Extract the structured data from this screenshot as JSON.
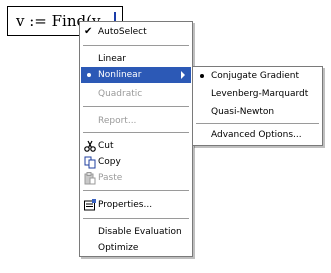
{
  "math": {
    "expression": "v := Find(v"
  },
  "main_menu": {
    "autoselect": "AutoSelect",
    "linear": "Linear",
    "nonlinear": "Nonlinear",
    "quadratic": "Quadratic",
    "report": "Report...",
    "cut": "Cut",
    "copy": "Copy",
    "paste": "Paste",
    "properties": "Properties...",
    "disable_evaluation": "Disable Evaluation",
    "optimize": "Optimize"
  },
  "sub_menu": {
    "conjugate_gradient": "Conjugate Gradient",
    "levenberg_marquardt": "Levenberg-Marquardt",
    "quasi_newton": "Quasi-Newton",
    "advanced_options": "Advanced Options..."
  },
  "icons": {
    "check": "checkmark-icon",
    "radio": "radio-bullet-icon",
    "submenu": "chevron-right-icon",
    "cut": "scissors-icon",
    "copy": "copy-icon",
    "paste": "paste-icon",
    "properties": "properties-icon"
  },
  "colors": {
    "highlight": "#2c59b6",
    "disabled_text": "#9a9a9a"
  }
}
